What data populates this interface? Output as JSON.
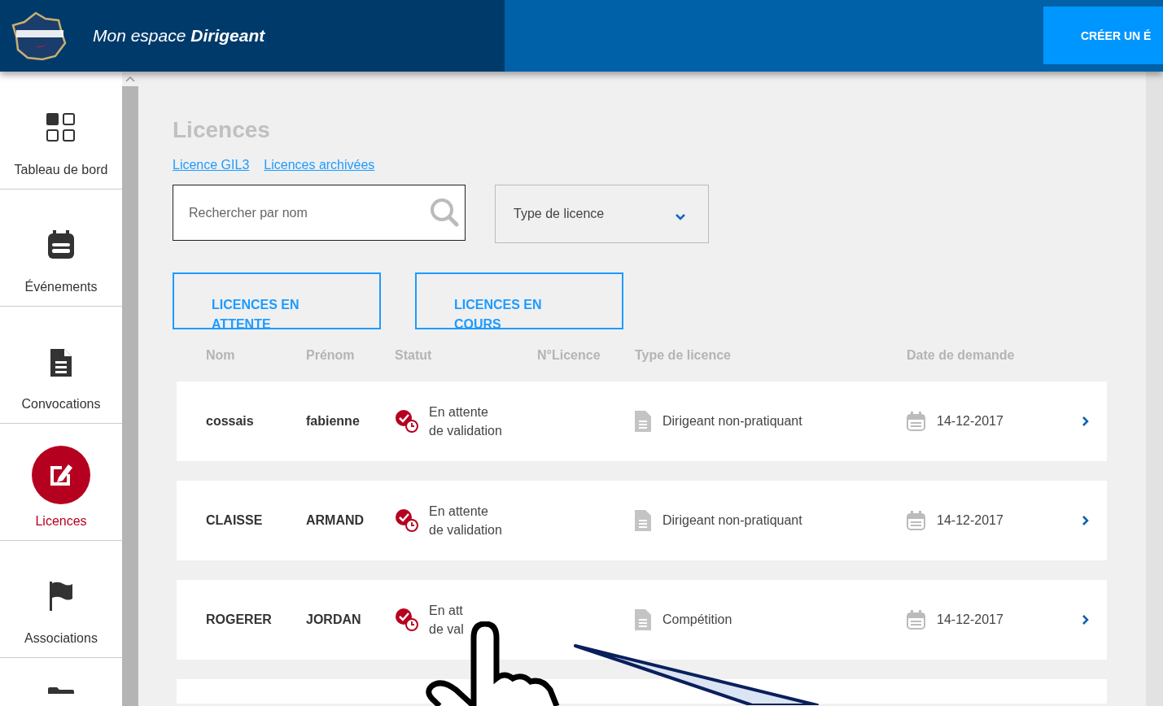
{
  "header": {
    "title_prefix": "Mon espace",
    "title_strong": "Dirigeant",
    "action": "CRÉER UN É"
  },
  "sidebar": {
    "items": [
      {
        "label": "Tableau de bord",
        "kind": "grid",
        "selected": false
      },
      {
        "label": "Événements",
        "kind": "calendar",
        "selected": false
      },
      {
        "label": "Convocations",
        "kind": "document",
        "selected": false
      },
      {
        "label": "Licences",
        "kind": "edit",
        "selected": true
      },
      {
        "label": "Associations",
        "kind": "flag",
        "selected": false
      }
    ]
  },
  "page": {
    "title": "Licences",
    "links": [
      "Licence GIL3",
      "Licences archivées"
    ]
  },
  "search": {
    "placeholder": "Rechercher par nom"
  },
  "filter": {
    "value": "Type de licence"
  },
  "tabs": [
    {
      "label": "LICENCES EN ATTENTE"
    },
    {
      "label": "LICENCES EN COURS"
    }
  ],
  "table": {
    "columns": [
      "Nom",
      "Prénom",
      "Statut",
      "N°Licence",
      "Type de licence",
      "Date de demande"
    ],
    "rows": [
      {
        "nom": "cossais",
        "prenom": "fabienne",
        "statut": [
          "En attente",
          "de validation"
        ],
        "type": "Dirigeant non-pratiquant",
        "date": "14-12-2017"
      },
      {
        "nom": "CLAISSE",
        "prenom": "ARMAND",
        "statut": [
          "En attente",
          "de validation"
        ],
        "type": "Dirigeant non-pratiquant",
        "date": "14-12-2017"
      },
      {
        "nom": "ROGERER",
        "prenom": "JORDAN",
        "statut": [
          "En att",
          "de val"
        ],
        "type": "Compétition",
        "date": "14-12-2017"
      }
    ]
  }
}
